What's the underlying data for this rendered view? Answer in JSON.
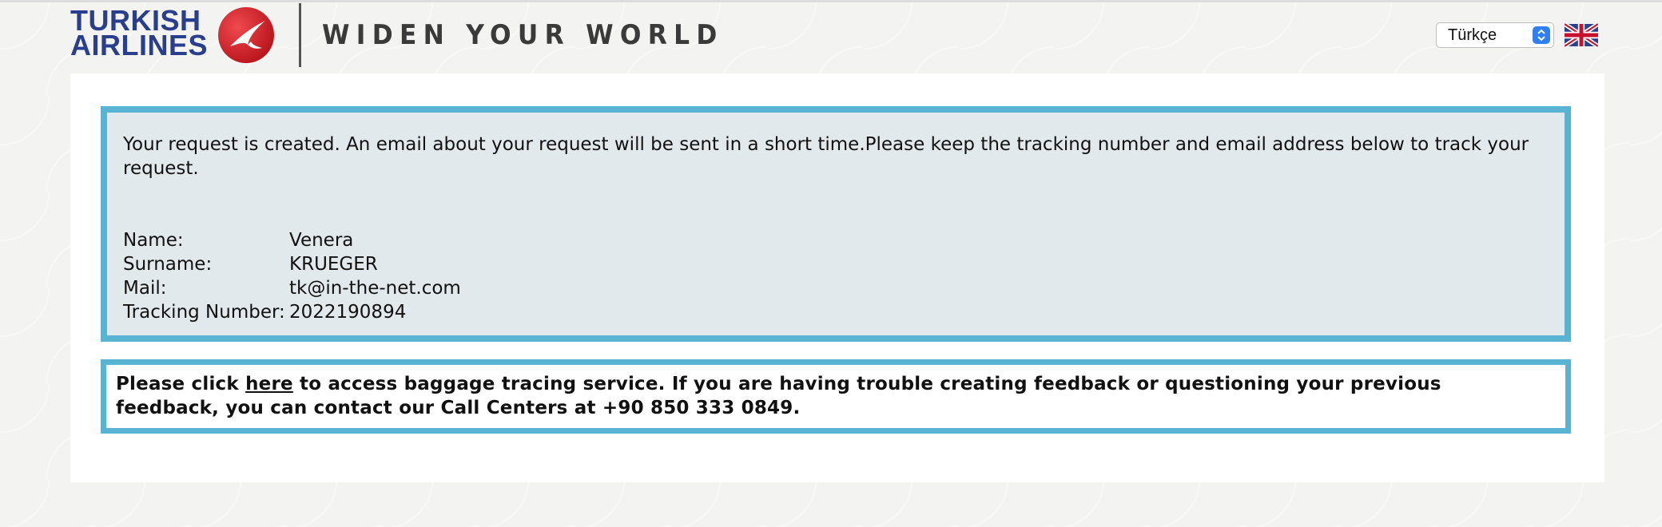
{
  "header": {
    "brand_line1": "TURKISH",
    "brand_line2": "AIRLINES",
    "tagline": "WIDEN YOUR WORLD",
    "language_selected": "Türkçe",
    "brand_color": "#2a3e8e",
    "logo_red": "#d32027",
    "logo_icon": "bird-logo-icon",
    "flag_icon": "uk-flag-icon"
  },
  "request": {
    "message": "Your request is created. An email about your request will be sent in a short time.Please keep the tracking number and email address below to track your request.",
    "fields": [
      {
        "label": "Name:",
        "value": "Venera"
      },
      {
        "label": "Surname:",
        "value": "KRUEGER"
      },
      {
        "label": "Mail:",
        "value": "tk@in-the-net.com"
      },
      {
        "label": "Tracking Number:",
        "value": "2022190894"
      }
    ]
  },
  "notice": {
    "text_before": "Please click ",
    "link_text": "here",
    "text_after": " to access baggage tracing service. If you are having trouble creating feedback or questioning your previous feedback, you can contact our Call Centers at +90 850 333 0849."
  },
  "colors": {
    "box_border": "#59b4d3",
    "info_background": "#e2e9ec"
  }
}
